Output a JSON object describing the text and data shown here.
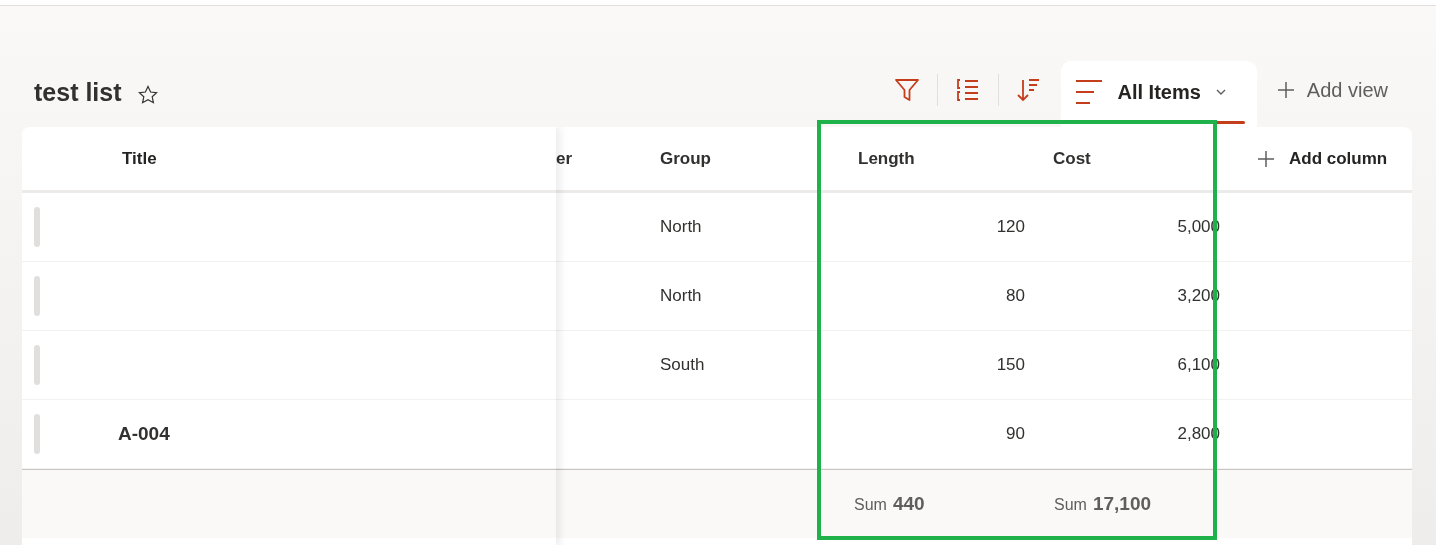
{
  "list": {
    "title": "test list",
    "favorite": false
  },
  "toolbar": {
    "views": [
      {
        "label": "All Items",
        "selected": true
      }
    ],
    "add_view": "Add view"
  },
  "table": {
    "frozen_column": "Title",
    "columns": [
      "er",
      "Group",
      "Length",
      "Cost"
    ],
    "add_column": "Add column",
    "rows": [
      {
        "group": "North",
        "length": "120",
        "cost": "5,000"
      },
      {
        "group": "North",
        "length": "80",
        "cost": "3,200"
      },
      {
        "group": "South",
        "length": "150",
        "cost": "6,100"
      },
      {
        "title": "A-004",
        "length": "90",
        "cost": "2,800"
      }
    ],
    "totals": {
      "length": {
        "label": "Sum",
        "value": "440"
      },
      "cost": {
        "label": "Sum",
        "value": "17,100"
      }
    }
  }
}
